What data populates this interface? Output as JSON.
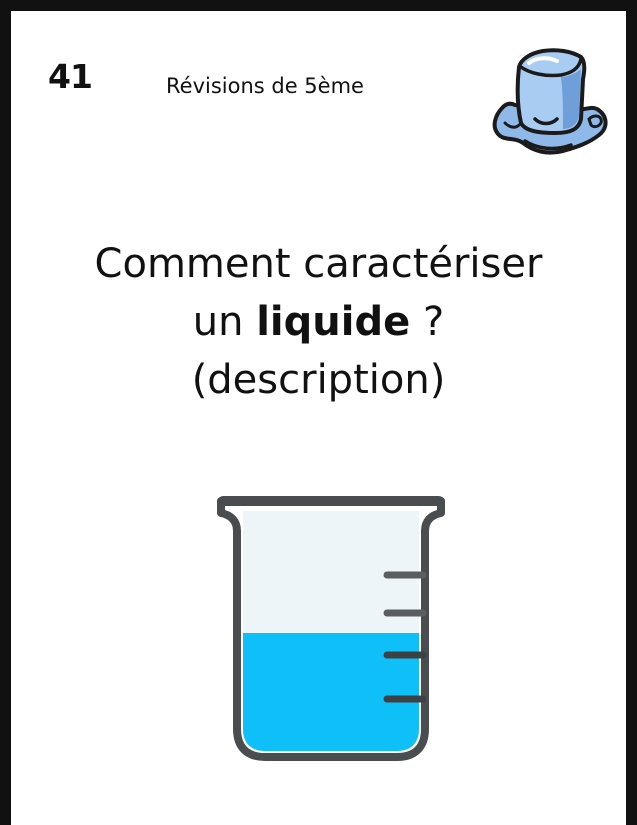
{
  "card": {
    "number": "41",
    "header_title": "Révisions de 5ème"
  },
  "question": {
    "line1": "Comment caractériser",
    "line2_prefix": "un ",
    "line2_bold": "liquide",
    "line2_suffix": " ?",
    "line3": "(description)"
  },
  "colors": {
    "border": "#111111",
    "ice": "#8fb9e9",
    "liquid": "#0ec0f7",
    "glass": "#eef5f8"
  },
  "icons": {
    "header": "melting-ice-cube-icon",
    "illustration": "beaker-icon"
  }
}
